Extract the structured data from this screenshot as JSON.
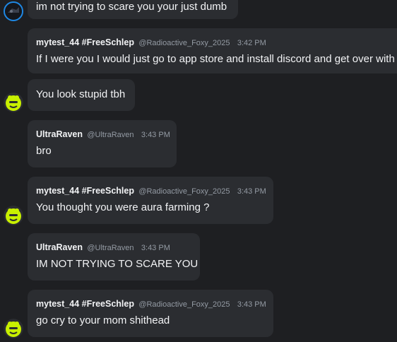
{
  "messages": [
    {
      "author": "",
      "handle": "",
      "time": "",
      "text": "im not trying to scare you your just dumb"
    },
    {
      "author": "mytest_44 #FreeSchlep",
      "handle": "@Radioactive_Foxy_2025",
      "time": "3:42 PM",
      "text": "If I were you I would just go to app store and install discord and get over with"
    },
    {
      "author": "",
      "handle": "",
      "time": "",
      "text": "You look stupid tbh"
    },
    {
      "author": "UltraRaven",
      "handle": "@UltraRaven",
      "time": "3:43 PM",
      "text": "bro"
    },
    {
      "author": "mytest_44 #FreeSchlep",
      "handle": "@Radioactive_Foxy_2025",
      "time": "3:43 PM",
      "text": "You thought you were aura farming ?"
    },
    {
      "author": "UltraRaven",
      "handle": "@UltraRaven",
      "time": "3:43 PM",
      "text": "IM NOT TRYING TO SCARE YOU"
    },
    {
      "author": "mytest_44 #FreeSchlep",
      "handle": "@Radioactive_Foxy_2025",
      "time": "3:43 PM",
      "text": "go cry to your mom shithead"
    }
  ],
  "colors": {
    "background": "#1e1f22",
    "bubble": "#2b2d31",
    "avatar_accent": "#c8f000",
    "ring": "#1e88e5"
  },
  "icons": {
    "avatar_dark": "dark-avatar-icon",
    "avatar_yellow": "yellow-creature-avatar-icon"
  }
}
